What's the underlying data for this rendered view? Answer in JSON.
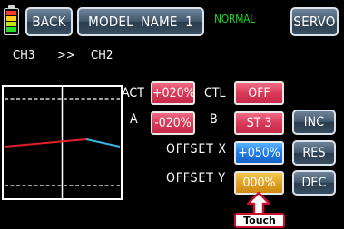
{
  "header": {
    "back_label": "BACK",
    "model_name": "MODEL NAME  1",
    "status": "NORMAL",
    "servo_label": "SERVO"
  },
  "channel": {
    "from": "CH3",
    "arrow": ">>",
    "to": "CH2"
  },
  "fields": {
    "act": {
      "label": "ACT",
      "value": "+020%"
    },
    "ctl": {
      "label": "CTL",
      "value": "OFF"
    },
    "a": {
      "label": "A",
      "value": "-020%"
    },
    "b": {
      "label": "B",
      "value": "ST 3"
    },
    "offset_x": {
      "label": "OFFSET X",
      "value": "+050%"
    },
    "offset_y": {
      "label": "OFFSET Y",
      "value": "000%"
    }
  },
  "side_buttons": {
    "inc": "INC",
    "res": "RES",
    "dec": "DEC"
  },
  "annotation": {
    "touch_label": "Touch"
  },
  "colors": {
    "status_green": "#19d329",
    "value_pink": "#d83a58",
    "value_blue": "#1f7be6",
    "value_gold": "#df9f22",
    "curve_red": "#e0202a",
    "curve_cyan": "#3fb6e6",
    "touch_red": "#c8102e"
  },
  "icons": {
    "battery": "battery-icon",
    "touch_arrow": "arrow-up-icon"
  }
}
